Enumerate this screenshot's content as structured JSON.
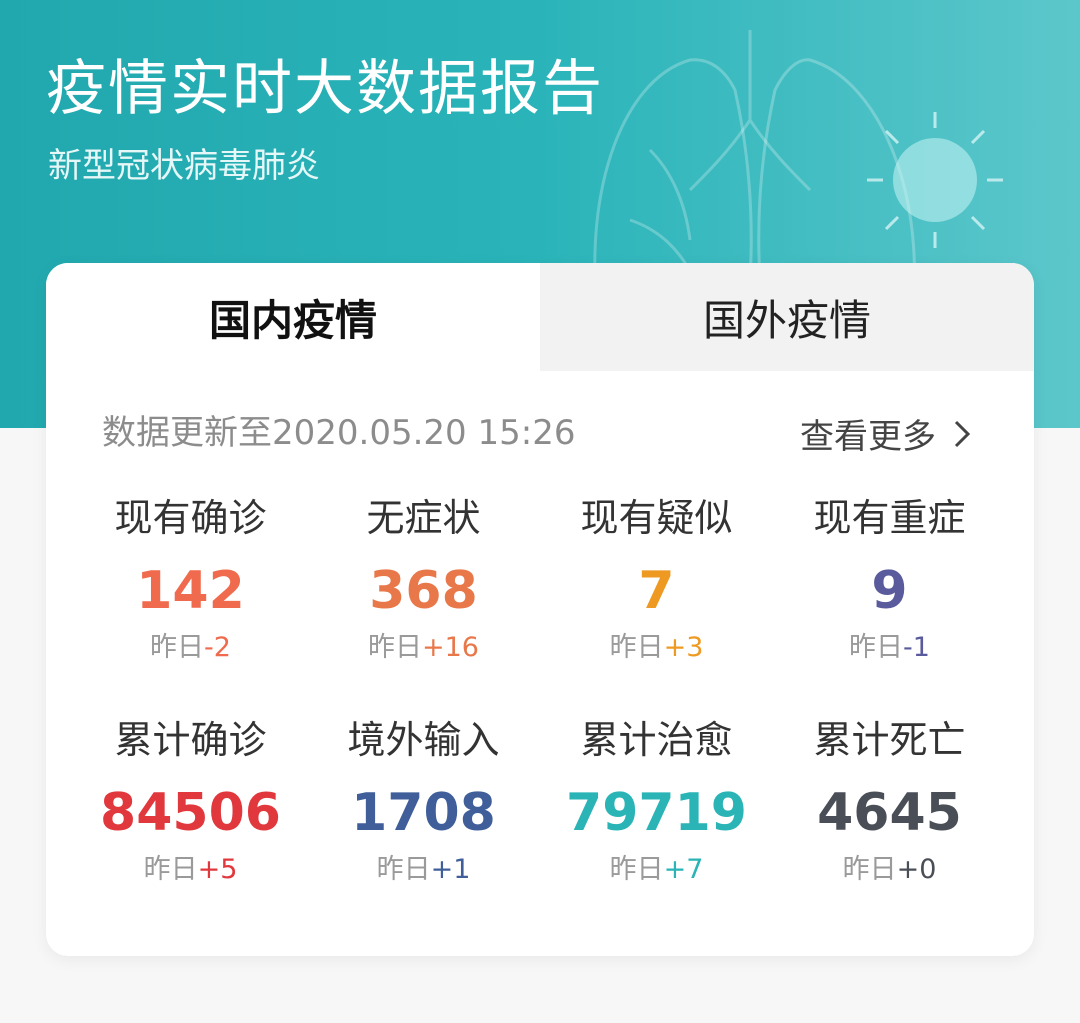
{
  "header": {
    "title": "疫情实时大数据报告",
    "subtitle": "新型冠状病毒肺炎"
  },
  "tabs": [
    {
      "label": "国内疫情",
      "active": true
    },
    {
      "label": "国外疫情",
      "active": false
    }
  ],
  "update": {
    "text": "数据更新至2020.05.20 15:26",
    "more_label": "查看更多"
  },
  "delta_prefix": "昨日",
  "stats": [
    {
      "label": "现有确诊",
      "value": "142",
      "delta": "-2",
      "color": "#f06a4d"
    },
    {
      "label": "无症状",
      "value": "368",
      "delta": "+16",
      "color": "#e8784a"
    },
    {
      "label": "现有疑似",
      "value": "7",
      "delta": "+3",
      "color": "#ee9a22"
    },
    {
      "label": "现有重症",
      "value": "9",
      "delta": "-1",
      "color": "#5a5b9c"
    },
    {
      "label": "累计确诊",
      "value": "84506",
      "delta": "+5",
      "color": "#e0383c"
    },
    {
      "label": "境外输入",
      "value": "1708",
      "delta": "+1",
      "color": "#3f5e9a"
    },
    {
      "label": "累计治愈",
      "value": "79719",
      "delta": "+7",
      "color": "#2ab4b6"
    },
    {
      "label": "累计死亡",
      "value": "4645",
      "delta": "+0",
      "color": "#4a4e57"
    }
  ],
  "colors": {
    "banner": "#21a8ae",
    "page_bg": "#f7f7f7"
  }
}
